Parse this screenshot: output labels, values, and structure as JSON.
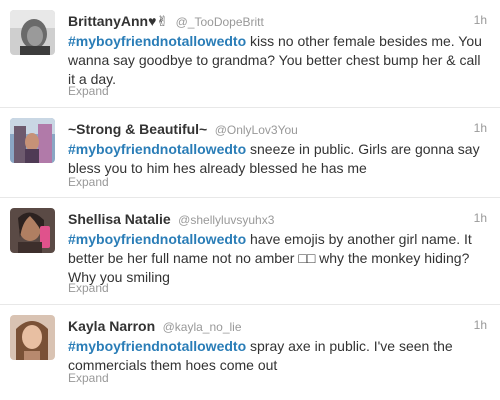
{
  "tweets": [
    {
      "fullname": "BrittanyAnn♥✌",
      "username": "@_TooDopeBritt",
      "time": "1h",
      "hashtag": "#myboyfriendnotallowedto",
      "text": " kiss no other female besides me. You wanna say goodbye to grandma? You better chest bump her & call it a day.",
      "expand": "Expand"
    },
    {
      "fullname": "~Strong & Beautiful~",
      "username": "@OnlyLov3You",
      "time": "1h",
      "hashtag": "#myboyfriendnotallowedto",
      "text": " sneeze in public. Girls are gonna say bless you to him hes already blessed he has me",
      "expand": "Expand"
    },
    {
      "fullname": "Shellisa Natalie",
      "username": "@shellyluvsyuhx3",
      "time": "1h",
      "hashtag": "#myboyfriendnotallowedto",
      "text": " have emojis by another girl name. It better be her full name not no amber □□ why the monkey hiding? Why you smiling",
      "expand": "Expand"
    },
    {
      "fullname": "Kayla Narron",
      "username": "@kayla_no_lie",
      "time": "1h",
      "hashtag": "#myboyfriendnotallowedto",
      "text": " spray axe in public. I've seen the commercials them hoes come out",
      "expand": "Expand"
    }
  ]
}
